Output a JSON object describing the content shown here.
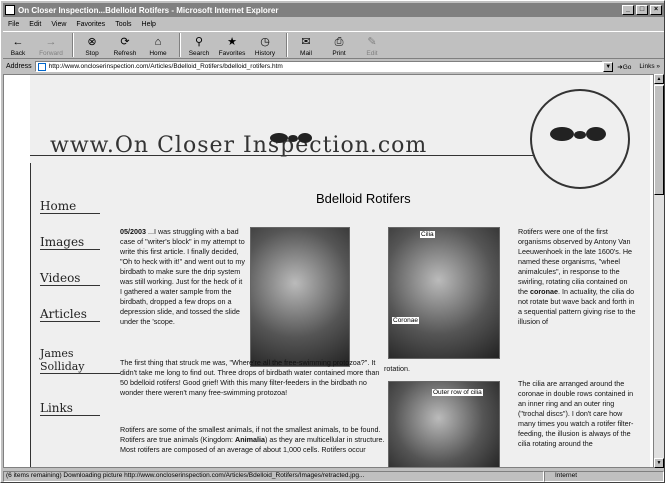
{
  "window": {
    "title": "On Closer Inspection...Bdelloid Rotifers - Microsoft Internet Explorer",
    "buttons": {
      "minimize": "_",
      "maximize": "□",
      "close": "×"
    }
  },
  "menu": [
    "File",
    "Edit",
    "View",
    "Favorites",
    "Tools",
    "Help"
  ],
  "toolbar": [
    {
      "label": "Back",
      "icon": "back-arrow-icon",
      "glyph": "←",
      "disabled": false
    },
    {
      "label": "Forward",
      "icon": "forward-arrow-icon",
      "glyph": "→",
      "disabled": true
    },
    {
      "label": "Stop",
      "icon": "stop-icon",
      "glyph": "⊗",
      "disabled": false
    },
    {
      "label": "Refresh",
      "icon": "refresh-icon",
      "glyph": "⟳",
      "disabled": false
    },
    {
      "label": "Home",
      "icon": "home-icon",
      "glyph": "⌂",
      "disabled": false
    },
    {
      "label": "Search",
      "icon": "search-icon",
      "glyph": "⚲",
      "disabled": false
    },
    {
      "label": "Favorites",
      "icon": "favorites-icon",
      "glyph": "★",
      "disabled": false
    },
    {
      "label": "History",
      "icon": "history-icon",
      "glyph": "◷",
      "disabled": false
    },
    {
      "label": "Mail",
      "icon": "mail-icon",
      "glyph": "✉",
      "disabled": false
    },
    {
      "label": "Print",
      "icon": "print-icon",
      "glyph": "⎙",
      "disabled": false
    },
    {
      "label": "Edit",
      "icon": "edit-icon",
      "glyph": "✎",
      "disabled": true
    }
  ],
  "address": {
    "label": "Address",
    "url": "http://www.oncloserinspection.com/Articles/Bdelloid_Rotifers/bdelloid_rotifers.htm",
    "go": "Go",
    "links": "Links"
  },
  "page": {
    "logo": "www.On Closer Inspection.com",
    "nav": [
      "Home",
      "Images",
      "Videos",
      "Articles",
      "James Solliday",
      "Links"
    ],
    "title": "Bdelloid Rotifers",
    "para1_date": "05/2003",
    "para1": "...I was struggling with a bad case of \"writer's block\" in my attempt to write this first article. I finally decided, \"Oh to heck with it!\" and went out to my birdbath to make sure the drip system was still working. Just for the heck of it I gathered a water sample from the birdbath, dropped a few drops on a depression slide, and tossed the slide under the 'scope.",
    "para2": "The first thing that struck me was, \"Where're all the free-swimming protozoa?\". It didn't take me long to find out. Three drops of birdbath water contained more than 50 bdelloid rotifers! Good grief! With this many filter-feeders in the birdbath no wonder there weren't many free-swimming protozoa!",
    "para3_a": "Rotifers are some of the smallest animals, if not the smallest animals, to be found. Rotifers are true animals (Kingdom: ",
    "para3_b": "Animalia",
    "para3_c": ") as they are multicellular in structure. Most rotifers are composed of an average of about 1,000 cells. Rotifers occur",
    "right1_a": "Rotifers were one of the first organisms observed by Antony Van Leeuwenhoek in the late 1600's. He named these organisms, \"wheel animalcules\", in response to the swirling, rotating cilia contained on the ",
    "right1_b": "coronae",
    "right1_c": ". In actuality, the cilia do not rotate but wave back and forth in a sequential pattern giving rise to the illusion of",
    "rotation": "rotation.",
    "right2": "The cilia are arranged around the coronae in double rows contained in an inner ring and an outer ring (\"trochal discs\"). I don't care how many times you watch a rotifer filter-feeding, the illusion is always of the cilia rotating around the",
    "callouts": {
      "cilia": "Cilia",
      "coronae": "Coronae",
      "outer_row": "Outer row of cilia"
    }
  },
  "status": {
    "text": "(6 items remaining) Downloading picture http://www.oncloserinspection.com/Articles/Bdelloid_Rotifers/Images/retracted.jpg...",
    "zone": "Internet"
  }
}
